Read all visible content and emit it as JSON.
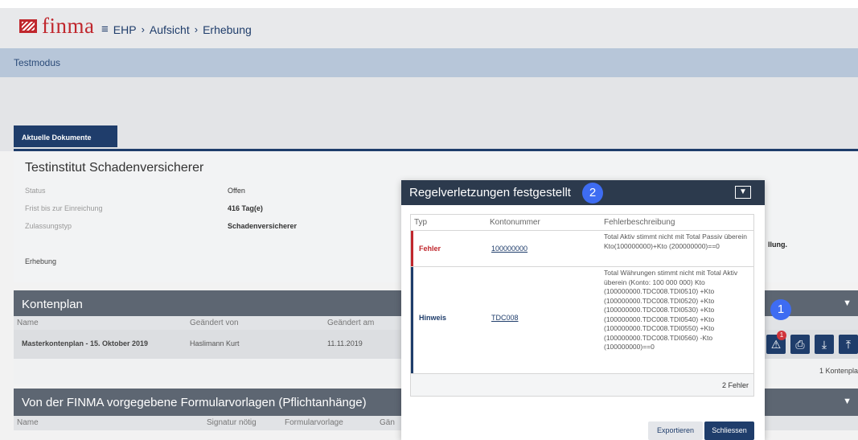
{
  "header": {
    "logo_text": "finma",
    "breadcrumb": [
      "EHP",
      "Aufsicht",
      "Erhebung"
    ]
  },
  "testmode": "Testmodus",
  "tabs": {
    "active": "Aktuelle Dokumente"
  },
  "document": {
    "title": "Testinstitut Schadenversicherer",
    "status_label": "Status",
    "status_value": "Offen",
    "deadline_label": "Frist bis zur Einreichung",
    "deadline_value": "416 Tag(e)",
    "type_label": "Zulassungstyp",
    "type_value": "Schadenversicherer",
    "erhebung": "Erhebung",
    "truncated_text": "llung."
  },
  "kontenplan": {
    "title": "Kontenplan",
    "columns": [
      "Name",
      "Geändert von",
      "Geändert am"
    ],
    "row": {
      "name": "Masterkontenplan - 15. Oktober 2019",
      "changed_by": "Haslimann Kurt",
      "changed_on": "11.11.2019"
    },
    "count": "1 Kontenpla"
  },
  "formular": {
    "title": "Von der FINMA vorgegebene Formularvorlagen (Pflichtanhänge)",
    "columns": [
      "Name",
      "Signatur nötig",
      "Formularvorlage",
      "Gän"
    ]
  },
  "callouts": {
    "one": "1",
    "two": "2",
    "mini": "1"
  },
  "modal": {
    "title": "Regelverletzungen festgestellt",
    "columns": [
      "Typ",
      "Kontonummer",
      "Fehlerbeschreibung"
    ],
    "rows": [
      {
        "typ": "Fehler",
        "konto": "100000000",
        "desc": "Total Aktiv stimmt nicht mit Total Passiv überein Kto(100000000)+Kto (200000000)==0"
      },
      {
        "typ": "Hinweis",
        "konto": "TDC008",
        "desc": "Total Währungen stimmt nicht mit Total Aktiv überein (Konto: 100 000 000) Kto (100000000.TDC008.TDI0510) +Kto (100000000.TDC008.TDI0520) +Kto (100000000.TDC008.TDI0530) +Kto (100000000.TDC008.TDI0540) +Kto (100000000.TDC008.TDI0550) +Kto (100000000.TDC008.TDI0560) -Kto (100000000)==0"
      }
    ],
    "footer": "2 Fehler",
    "export_label": "Exportieren",
    "close_label": "Schliessen"
  },
  "colors": {
    "brand": "#c0272d",
    "navy": "#1f3d6b",
    "error": "#c0272d",
    "hint": "#1f3d6b",
    "callout": "#3e6cf2"
  }
}
